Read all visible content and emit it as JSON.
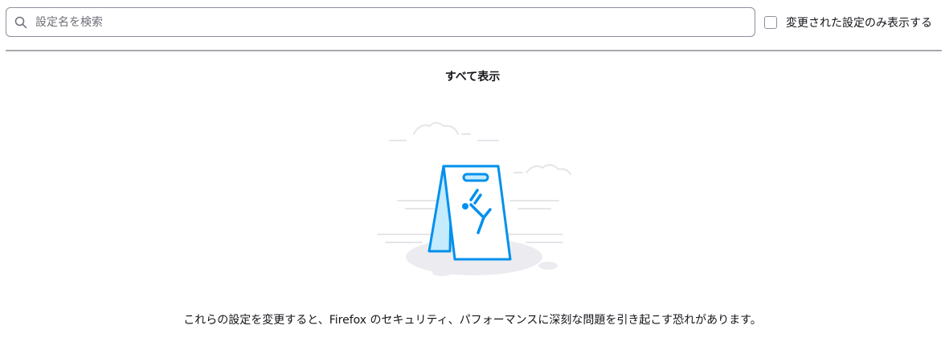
{
  "search": {
    "placeholder": "設定名を検索",
    "value": ""
  },
  "filter": {
    "show_modified_label": "変更された設定のみ表示する",
    "checked": false
  },
  "show_all_label": "すべて表示",
  "warning_message": "これらの設定を変更すると、Firefox のセキュリティ、パフォーマンスに深刻な問題を引き起こす恐れがあります。",
  "illustration": {
    "icon": "caution-sign-slipping-person-icon",
    "accent_color": "#0090ed",
    "light_fill": "#c5ebff"
  }
}
